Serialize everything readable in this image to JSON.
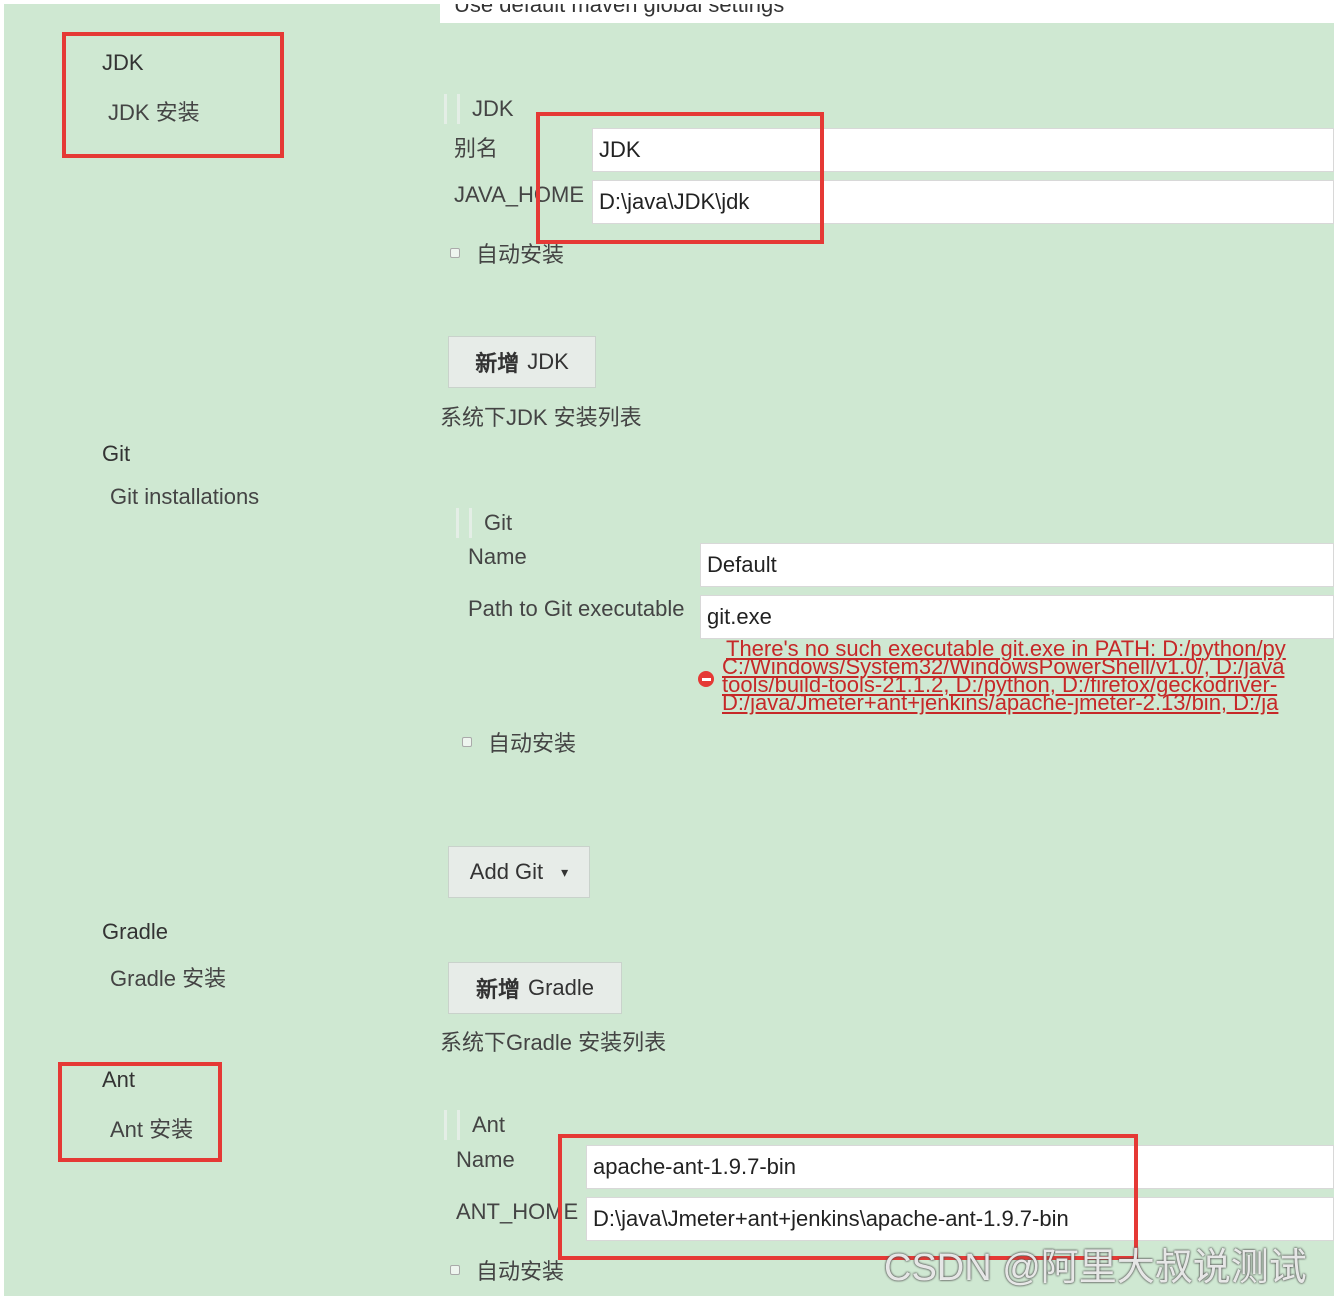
{
  "top": {
    "maven_global_text": "Use default maven global settings"
  },
  "jdk": {
    "section_title": "JDK",
    "section_subtitle": "JDK 安装",
    "group_title": "JDK",
    "alias_label": "别名",
    "alias_value": "JDK",
    "home_label": "JAVA_HOME",
    "home_value": "D:\\java\\JDK\\jdk",
    "auto_install_label": "自动安装",
    "add_button_prefix": "新增",
    "add_button_label": "JDK",
    "list_caption": "系统下JDK 安装列表"
  },
  "git": {
    "section_title": "Git",
    "section_subtitle": "Git installations",
    "group_title": "Git",
    "name_label": "Name",
    "name_value": "Default",
    "path_label": "Path to Git executable",
    "path_value": "git.exe",
    "error_lines": [
      "There's no such executable git.exe in PATH: D:/python/py",
      "C:/Windows/System32/WindowsPowerShell/v1.0/, D:/java",
      "tools/build-tools-21.1.2, D:/python, D:/firefox/geckodriver-",
      "D:/java/Jmeter+ant+jenkins/apache-jmeter-2.13/bin, D:/ja"
    ],
    "auto_install_label": "自动安装",
    "add_button_label": "Add Git",
    "dropdown_glyph": "▾"
  },
  "gradle": {
    "section_title": "Gradle",
    "section_subtitle": "Gradle 安装",
    "add_button_prefix": "新增",
    "add_button_label": "Gradle",
    "list_caption": "系统下Gradle 安装列表"
  },
  "ant": {
    "section_title": "Ant",
    "section_subtitle": "Ant 安装",
    "group_title": "Ant",
    "name_label": "Name",
    "name_value": "apache-ant-1.9.7-bin",
    "home_label": "ANT_HOME",
    "home_value": "D:\\java\\Jmeter+ant+jenkins\\apache-ant-1.9.7-bin",
    "auto_install_label": "自动安装"
  },
  "watermark": {
    "text": "CSDN @阿里大叔说测试"
  },
  "colors": {
    "background": "#cfe8d2",
    "highlight": "#e53935",
    "error": "#c62828"
  },
  "icons": {
    "error": "error-icon",
    "dropdown": "chevron-down-icon",
    "handle": "drag-handle-icon"
  }
}
